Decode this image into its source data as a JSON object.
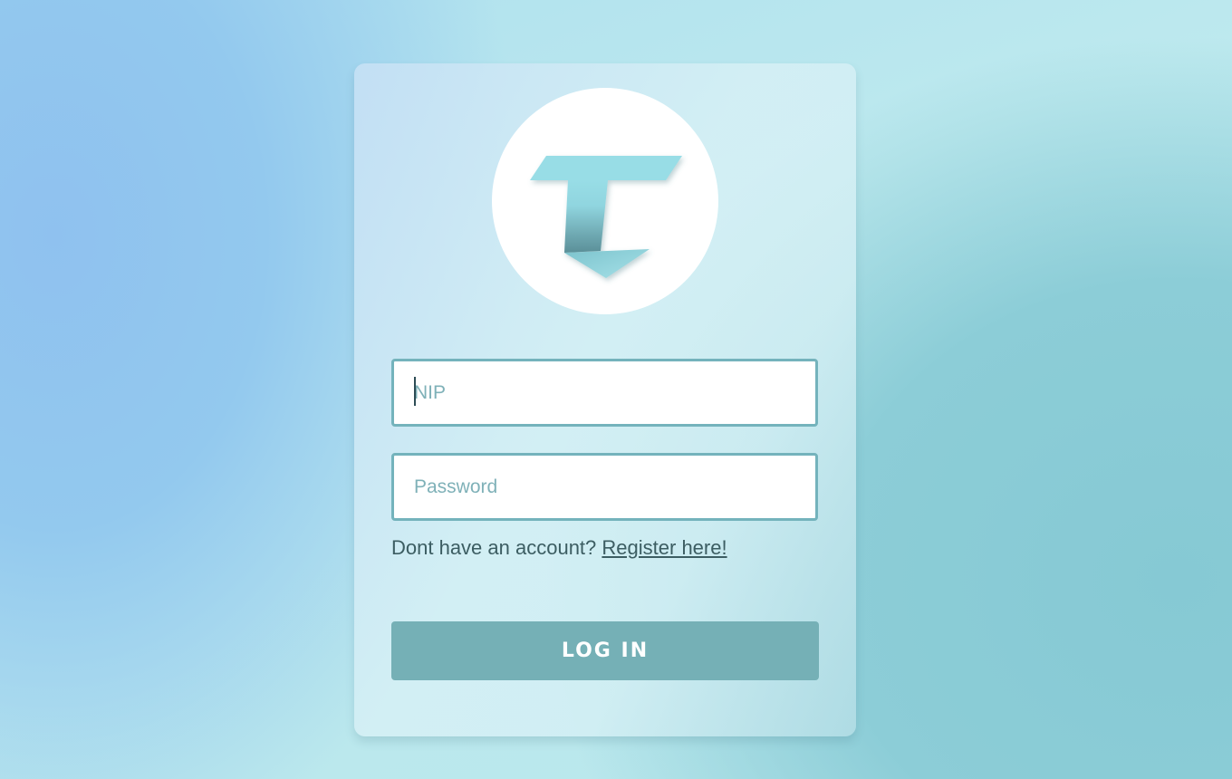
{
  "login": {
    "nip_placeholder": "NIP",
    "nip_value": "",
    "password_placeholder": "Password",
    "password_value": "",
    "register_prompt": "Dont have an account?",
    "register_link": "Register here!",
    "login_button": "LOG IN"
  },
  "logo": {
    "icon": "t-ribbon-arrow-logo-icon"
  },
  "colors": {
    "accent": "#75b0b6",
    "field_border": "#74b3bc",
    "text": "#3c5d62",
    "logo_light": "#97dce6",
    "logo_dark": "#5fa3ad"
  }
}
